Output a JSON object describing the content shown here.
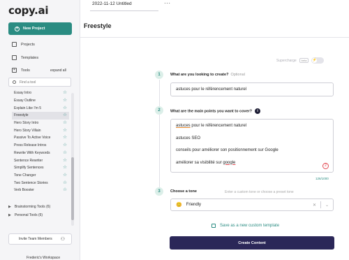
{
  "app": {
    "logo": "copy.ai"
  },
  "sidebar": {
    "new_project": "New Project",
    "projects": "Projects",
    "templates": "Templates",
    "tools": "Tools",
    "expand_all": "expand all",
    "find_placeholder": "Find a tool",
    "tool_items": [
      "Essay Intro",
      "Essay Outline",
      "Explain Like I'm 5",
      "Freestyle",
      "Hero Story Intro",
      "Hero Story Villain",
      "Passive To Active Voice",
      "Press Release Intros",
      "Rewrite With Keywords",
      "Sentence Rewriter",
      "Simplify Sentences",
      "Tone Changer",
      "Two Sentence Stories",
      "Verb Booster"
    ],
    "active_tool": "Freestyle",
    "groups": [
      "Brainstorming Tools (6)",
      "Personal Tools (6)"
    ],
    "invite": "Invite Team Members",
    "workspace": "Frederic's Workspace"
  },
  "topbar": {
    "doc_title": "2022-11-12 Untitled",
    "more": "···"
  },
  "header": {
    "title": "Freestyle"
  },
  "supercharge": {
    "label": "Supercharge",
    "badge": "beta"
  },
  "form": {
    "q1": {
      "number": "1",
      "label": "What are you looking to create?",
      "optional": "Optional",
      "value": "astuces pour le référencement naturel"
    },
    "q2": {
      "number": "2",
      "label": "What are the main points you want to cover?",
      "lines": [
        {
          "a": "astuces",
          "b": " pour le référencement naturel",
          "c": ""
        },
        {
          "a": "",
          "b": "astuces SEO",
          "c": ""
        },
        {
          "a": "",
          "b": "conseils pour améliorer son positionnement sur Google",
          "c": ""
        },
        {
          "a": "",
          "b": "améliorer sa visibilité sur ",
          "c": "google"
        }
      ],
      "error_count": "2",
      "counter": "126/1000"
    },
    "q3": {
      "number": "3",
      "label": "Choose a tone",
      "hint": "Enter a custom tone or choose a preset tone",
      "value": "Friendly"
    },
    "save_template": "Save as a new custom template",
    "create": "Create Content"
  }
}
